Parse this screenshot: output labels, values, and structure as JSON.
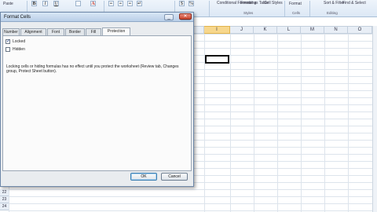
{
  "ribbon": {
    "paste_label": "Paste",
    "bold_label": "B",
    "italic_label": "I",
    "underline_label": "U",
    "conditional_formatting_label": "Conditional Formatting",
    "format_as_table_label": "Format as Table",
    "cell_styles_label": "Cell Styles",
    "format_label": "Format",
    "sort_filter_label": "Sort & Filter",
    "find_select_label": "Find & Select",
    "group_styles": "Styles",
    "group_cells": "Cells",
    "group_editing": "Editing"
  },
  "sheet": {
    "columns": [
      "I",
      "J",
      "K",
      "L",
      "M",
      "N",
      "O"
    ],
    "selected_column": "I",
    "rows": [
      "22",
      "23",
      "24"
    ]
  },
  "dialog": {
    "title": "Format Cells",
    "tabs": [
      "Number",
      "Alignment",
      "Font",
      "Border",
      "Fill",
      "Protection"
    ],
    "active_tab": "Protection",
    "locked_label": "Locked",
    "locked_checked": true,
    "hidden_label": "Hidden",
    "hidden_checked": false,
    "description": "Locking cells or hiding formulas has no effect until you protect the worksheet (Review tab, Changes group, Protect Sheet button).",
    "ok_label": "OK",
    "cancel_label": "Cancel"
  },
  "colors": {
    "ribbon_bg": "#dce8f5",
    "selected_header": "#f7d78c",
    "dialog_bg": "#e9ecef",
    "close_button": "#c8432c"
  },
  "icons": [
    "minimize-icon",
    "maximize-icon",
    "close-icon",
    "checkmark-icon",
    "font-color-icon"
  ]
}
